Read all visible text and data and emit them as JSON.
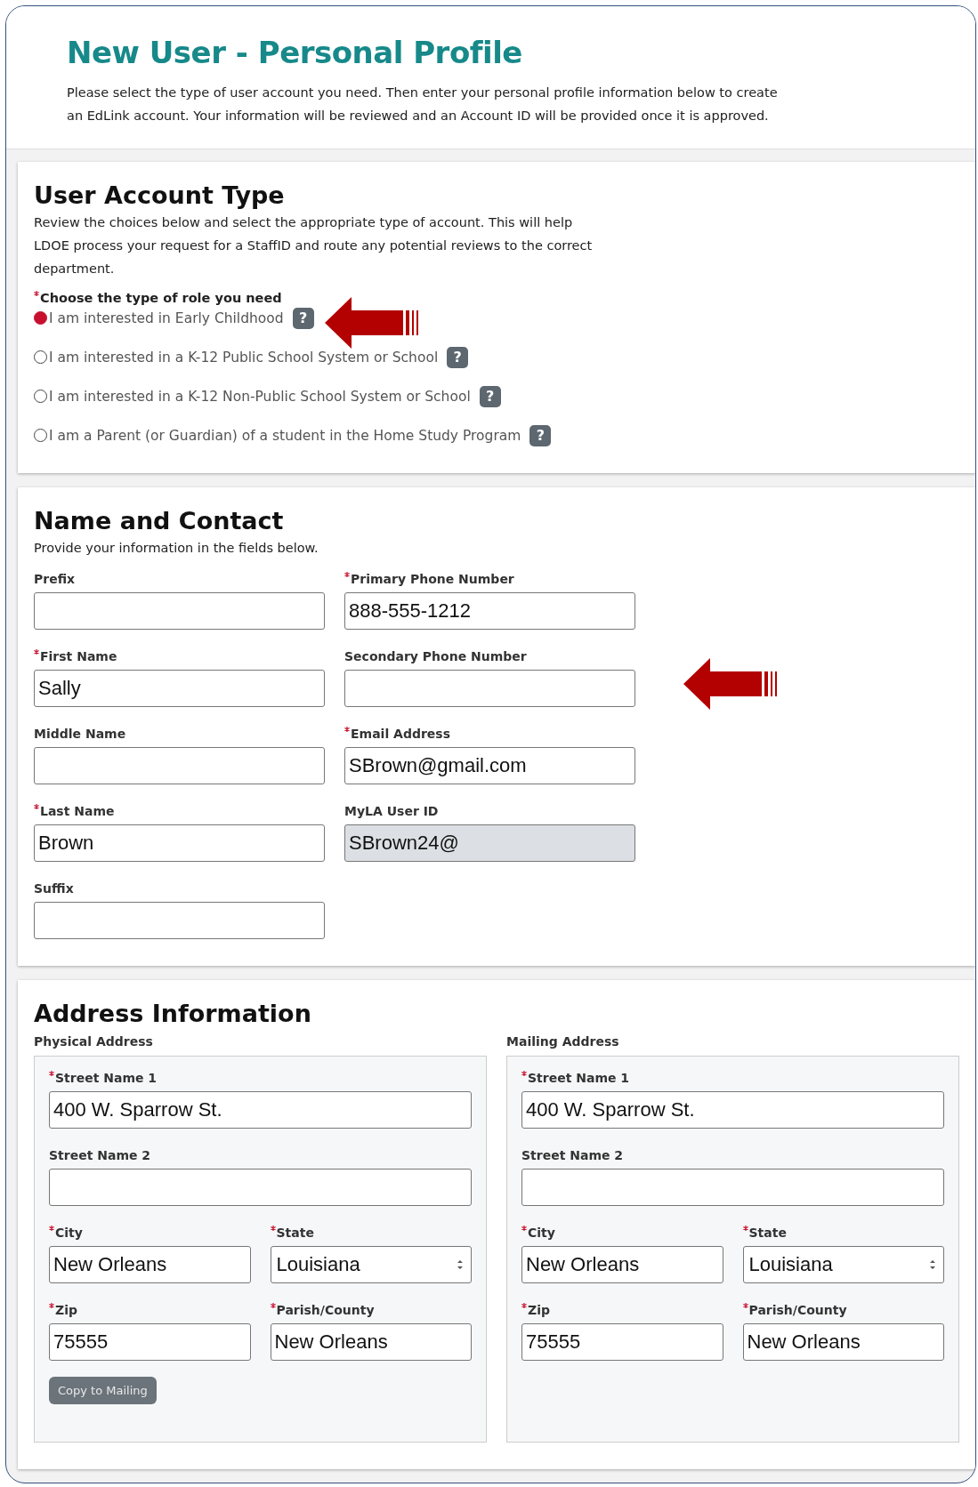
{
  "header": {
    "title": "New User - Personal Profile",
    "intro": "Please select the type of user account you need. Then enter your personal profile information below to create an EdLink account. Your information will be reviewed and an Account ID will be provided once it is approved."
  },
  "account_type": {
    "heading": "User Account Type",
    "description": "Review the choices below and select the appropriate type of account. This will help LDOE process your request for a StaffID and route any potential reviews to the correct department.",
    "question": {
      "label": "Choose the type of role you need",
      "required": true
    },
    "options": [
      {
        "label": "I am interested in Early Childhood",
        "help": "?",
        "selected": true
      },
      {
        "label": "I am interested in a K-12 Public School System or School",
        "help": "?",
        "selected": false
      },
      {
        "label": "I am interested in a K-12 Non-Public School System or School",
        "help": "?",
        "selected": false
      },
      {
        "label": "I am a Parent (or Guardian) of a student in the Home Study Program",
        "help": "?",
        "selected": false
      }
    ]
  },
  "name_contact": {
    "heading": "Name and Contact",
    "description": "Provide your information in the fields below.",
    "left_column": [
      {
        "label": "Prefix",
        "required": false,
        "disabled": false
      },
      {
        "label": "First Name",
        "required": true,
        "disabled": false,
        "value": "Sally"
      },
      {
        "label": "Middle Name",
        "required": false,
        "disabled": false
      },
      {
        "label": "Last Name",
        "required": true,
        "disabled": false,
        "value": "Brown"
      },
      {
        "label": "Suffix",
        "required": false,
        "disabled": false
      }
    ],
    "right_column": [
      {
        "label": "Primary Phone Number",
        "required": true,
        "disabled": false,
        "value": "888-555-1212"
      },
      {
        "label": "Secondary Phone Number",
        "required": false,
        "disabled": false
      },
      {
        "label": "Email Address",
        "required": true,
        "disabled": false,
        "value": "SBrown@gmail.com"
      },
      {
        "label": "MyLA User ID",
        "required": false,
        "disabled": true,
        "value": "SBrown24@"
      }
    ]
  },
  "address": {
    "heading": "Address Information",
    "panels": [
      {
        "title": "Physical Address",
        "button": "Copy to Mailing",
        "fields": [
          {
            "label": "Street Name 1",
            "required": true,
            "kind": "text",
            "value": "400 W. Sparrow St."
          },
          {
            "label": "Street Name 2",
            "required": false,
            "kind": "text"
          },
          {
            "label": "City",
            "required": true,
            "kind": "text",
            "value": "New Orleans"
          },
          {
            "label": "State",
            "required": true,
            "kind": "select",
            "value": "Louisiana"
          },
          {
            "label": "Zip",
            "required": true,
            "kind": "text",
            "value": "75555"
          },
          {
            "label": "Parish/County",
            "required": true,
            "kind": "text",
            "value": "New Orleans"
          }
        ]
      },
      {
        "title": "Mailing Address",
        "fields": [
          {
            "label": "Street Name 1",
            "required": true,
            "kind": "text",
            "value": "400 W. Sparrow St."
          },
          {
            "label": "Street Name 2",
            "required": false,
            "kind": "text"
          },
          {
            "label": "City",
            "required": true,
            "kind": "text",
            "value": "New Orleans"
          },
          {
            "label": "State",
            "required": true,
            "kind": "select",
            "value": "Louisiana"
          },
          {
            "label": "Zip",
            "required": true,
            "kind": "text",
            "value": "75555"
          },
          {
            "label": "Parish/County",
            "required": true,
            "kind": "text",
            "value": "New Orleans"
          }
        ]
      }
    ]
  }
}
